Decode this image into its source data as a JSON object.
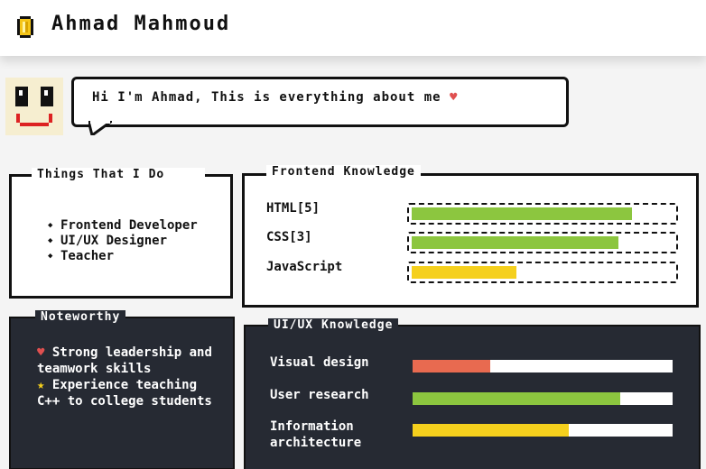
{
  "header": {
    "name": "Ahmad Mahmoud",
    "coin_icon": "coin-icon"
  },
  "intro": {
    "text": "Hi I'm Ahmad, This is everything about me",
    "heart": "♥",
    "avatar_icon": "smiley-avatar-icon"
  },
  "things": {
    "title": "Things That I Do",
    "items": [
      "Frontend Developer",
      "UI/UX Designer",
      "Teacher"
    ]
  },
  "frontend": {
    "title": "Frontend Knowledge",
    "skills": [
      {
        "label": "HTML[5]",
        "level": 0.84,
        "color": "#8cc63f"
      },
      {
        "label": "CSS[3]",
        "level": 0.79,
        "color": "#8cc63f"
      },
      {
        "label": "JavaScript",
        "level": 0.4,
        "color": "#f5d01d"
      }
    ]
  },
  "noteworthy": {
    "title": "Noteworthy",
    "items": [
      {
        "icon": "♥",
        "icon_name": "heart-icon",
        "icon_color": "#e05050",
        "text": "Strong leadership and teamwork skills"
      },
      {
        "icon": "★",
        "icon_name": "star-icon",
        "icon_color": "#f5d01d",
        "text": "Experience teaching C++ to college students"
      }
    ]
  },
  "uiux": {
    "title": "UI/UX Knowledge",
    "skills": [
      {
        "label": "Visual design",
        "level": 0.3,
        "color": "#e86a50"
      },
      {
        "label": "User research",
        "level": 0.8,
        "color": "#8cc63f"
      },
      {
        "label": "Information architecture",
        "level": 0.6,
        "color": "#f5d01d"
      }
    ]
  }
}
